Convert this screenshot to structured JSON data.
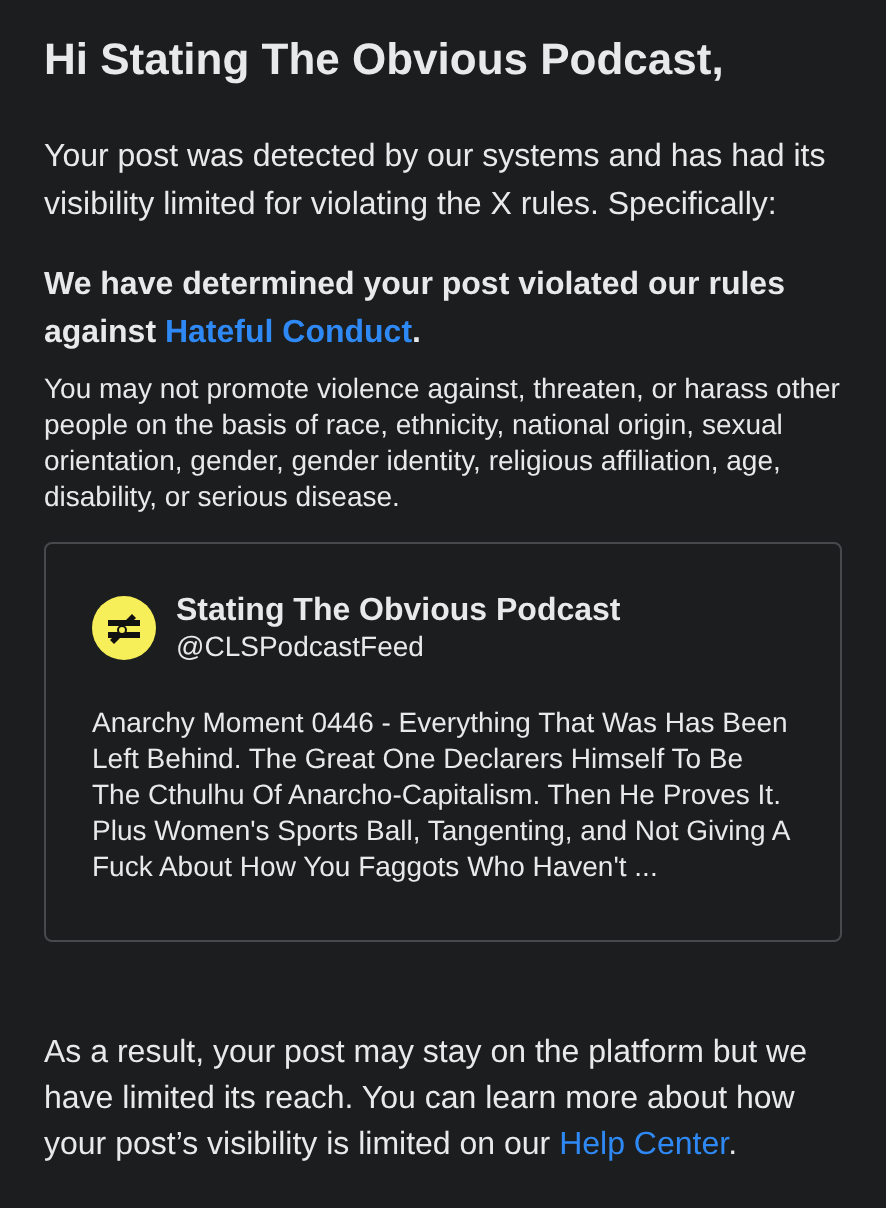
{
  "greeting": "Hi Stating The Obvious Podcast,",
  "intro": "Your post was detected by our systems and has had its visibility limited for violating the X rules. Specifically:",
  "violation": {
    "text_before": "We have determined your post violated our rules against ",
    "link": "Hateful Conduct",
    "text_after": "."
  },
  "policy": "You may not promote violence against, threaten, or harass other people on the basis of race, ethnicity, national origin, sexual orientation, gender, gender identity, religious affiliation, age, disability, or serious disease.",
  "post": {
    "display_name": "Stating The Obvious Podcast",
    "handle": "@CLSPodcastFeed",
    "text": "Anarchy Moment 0446 - Everything That Was Has Been Left Behind. The Great One Declarers Himself To Be The Cthulhu Of Anarcho-Capitalism. Then He Proves It. Plus Women's Sports Ball, Tangenting, and Not Giving A Fuck About How You Faggots Who Haven't ..."
  },
  "outcome": {
    "text_before": "As a result, your post may stay on the platform but we have limited its reach. You can learn more about how your post’s visibility is limited on our ",
    "link": "Help Center",
    "text_after": "."
  }
}
